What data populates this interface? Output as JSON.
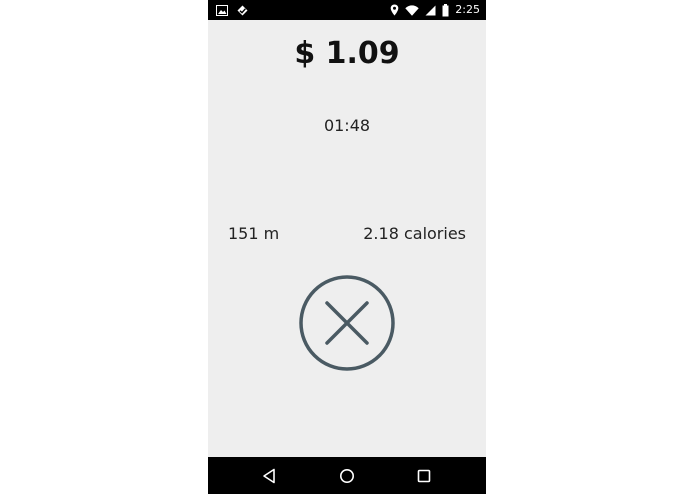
{
  "status_bar": {
    "time": "2:25",
    "left_icons": [
      "image-notification-icon",
      "app-notification-icon"
    ],
    "right_icons": [
      "location-icon",
      "wifi-icon",
      "cell-signal-icon",
      "battery-icon"
    ]
  },
  "ride": {
    "price": "$ 1.09",
    "elapsed_time": "01:48",
    "distance": "151 m",
    "calories": "2.18 calories"
  },
  "actions": {
    "cancel_icon": "close-circle-icon"
  },
  "nav_bar": {
    "buttons": [
      "back-icon",
      "home-icon",
      "recents-icon"
    ]
  },
  "colors": {
    "background": "#eeeeee",
    "bars": "#000000",
    "cancel_icon": "#4a5a63",
    "text": "#222222"
  }
}
